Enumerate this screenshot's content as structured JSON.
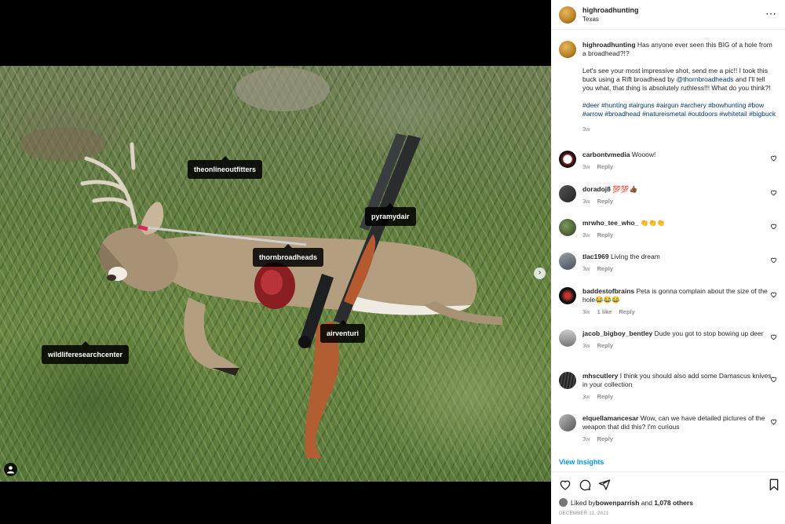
{
  "post": {
    "username": "highroadhunting",
    "location": "Texas",
    "more_icon": "more-horizontal-icon"
  },
  "photo_tags": [
    {
      "label": "theonlineoutfitters"
    },
    {
      "label": "pyramydair"
    },
    {
      "label": "thornbroadheads"
    },
    {
      "label": "airventuri"
    },
    {
      "label": "wildliferesearchcenter"
    }
  ],
  "caption": {
    "username": "highroadhunting",
    "line1": "Has anyone ever seen this BIG of a hole from a broadhead?!?",
    "line2_a": "Let's see your most impressive shot, send me a pic!! I took this buck using a Rift broadhead by ",
    "line2_mention": "@thornbroadheads",
    "line2_b": " and I'll tell you what, that thing is absolutely ruthless!!! What do you think?!",
    "hashtags": "#deer #hunting #airguns #airgun #archery #bowhunting #bow #arrow #broadhead #natureismetal #outdoors #whitetail #bigbuck",
    "time": "3w"
  },
  "comments": [
    {
      "username": "carbontvmedia",
      "text": "Wooow!",
      "time": "3w",
      "likes": "",
      "reply": "Reply"
    },
    {
      "username": "doradoj8",
      "text": "💯💯👍🏾",
      "time": "3w",
      "likes": "",
      "reply": "Reply"
    },
    {
      "username": "mrwho_tee_who_",
      "text": "👏👏👏",
      "time": "3w",
      "likes": "",
      "reply": "Reply"
    },
    {
      "username": "tlac1969",
      "text": "Living the dream",
      "time": "3w",
      "likes": "",
      "reply": "Reply"
    },
    {
      "username": "baddestofbrains",
      "text": "Peta is gonna complain about the size of the hole😂😂😂",
      "time": "3w",
      "likes": "1 like",
      "reply": "Reply"
    },
    {
      "username": "jacob_bigboy_bentley",
      "text": "Dude you got to stop bowing up deer",
      "time": "3w",
      "likes": "",
      "reply": "Reply"
    },
    {
      "username": "mhscutlery",
      "text": "I think you should also add some Damascus knives in your collection",
      "time": "3w",
      "likes": "",
      "reply": "Reply"
    },
    {
      "username": "elquellamancesar",
      "text": "Wow, can we have detailed pictures of the weapon that did this? I'm curious",
      "time": "3w",
      "likes": "",
      "reply": "Reply"
    }
  ],
  "view_insights": "View Insights",
  "likes": {
    "prefix": "Liked by ",
    "user": "bowenparrish",
    "joiner": " and ",
    "others": "1,078 others"
  },
  "date": "DECEMBER 11, 2021",
  "colors": {
    "link": "#00376b",
    "accent": "#0095f6",
    "muted": "#8e8e8e"
  }
}
